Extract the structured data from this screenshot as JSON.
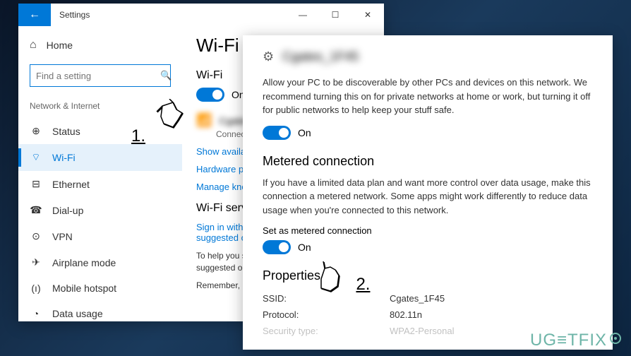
{
  "settingsWindow": {
    "title": "Settings",
    "home": "Home",
    "searchPlaceholder": "Find a setting",
    "category": "Network & Internet",
    "nav": [
      {
        "icon": "🖥",
        "label": "Status"
      },
      {
        "icon": "📶",
        "label": "Wi-Fi"
      },
      {
        "icon": "🖧",
        "label": "Ethernet"
      },
      {
        "icon": "📞",
        "label": "Dial-up"
      },
      {
        "icon": "🔒",
        "label": "VPN"
      },
      {
        "icon": "✈",
        "label": "Airplane mode"
      },
      {
        "icon": "📡",
        "label": "Mobile hotspot"
      },
      {
        "icon": "📊",
        "label": "Data usage"
      }
    ],
    "pageTitle": "Wi-Fi",
    "wifiSection": "Wi-Fi",
    "wifiToggle": "On",
    "networkName": "Cgates_1F45",
    "networkStatus": "Connected, secu",
    "links": {
      "showAvailable": "Show available networ",
      "hardwareProps": "Hardware properties",
      "manageKnown": "Manage known netwo"
    },
    "servicesHeading": "Wi-Fi services",
    "signInLink": "Sign in with your Micro\nsuggested open hotsp",
    "helpText": "To help you stay conne\nsuggested open Wi-Fi",
    "rememberText": "Remember, not all Wi-"
  },
  "networkWindow": {
    "headerName": "Cgates_1F45",
    "discoverDesc": "Allow your PC to be discoverable by other PCs and devices on this network. We recommend turning this on for private networks at home or work, but turning it off for public networks to help keep your stuff safe.",
    "discoverToggle": "On",
    "meteredHeading": "Metered connection",
    "meteredDesc": "If you have a limited data plan and want more control over data usage, make this connection a metered network. Some apps might work differently to reduce data usage when you're connected to this network.",
    "meteredLabel": "Set as metered connection",
    "meteredToggle": "On",
    "propsHeading": "Properties",
    "props": [
      {
        "key": "SSID:",
        "val": "Cgates_1F45"
      },
      {
        "key": "Protocol:",
        "val": "802.11n"
      },
      {
        "key": "Security type:",
        "val": "WPA2-Personal"
      }
    ]
  },
  "callouts": {
    "c1": "1.",
    "c2": "2."
  },
  "watermark": "UG≡TFIX"
}
